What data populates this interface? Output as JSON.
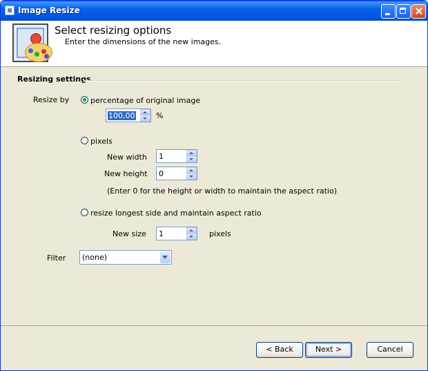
{
  "window": {
    "title": "Image Resize"
  },
  "header": {
    "title": "Select resizing options",
    "subtitle": "Enter the dimensions of the new images.",
    "icon": "paint-palette-image-icon"
  },
  "group": {
    "title": "Resizing settings"
  },
  "resize_by": {
    "label": "Resize by",
    "percentage": {
      "label": "percentage of original image",
      "value": "100,00",
      "unit": "%",
      "checked": true
    },
    "pixels": {
      "label": "pixels",
      "checked": false,
      "width_label": "New width",
      "width_value": "1",
      "height_label": "New height",
      "height_value": "0",
      "hint": "(Enter 0 for the height or width to maintain the aspect ratio)"
    },
    "longest": {
      "label": "resize longest side and maintain aspect ratio",
      "checked": false,
      "size_label": "New size",
      "size_value": "1",
      "unit": "pixels"
    }
  },
  "filter": {
    "label": "Filter",
    "value": "(none)"
  },
  "buttons": {
    "back": "< Back",
    "next": "Next >",
    "cancel": "Cancel"
  },
  "colors": {
    "titlebar": "#0054E3",
    "background": "#ECE9D8",
    "selection": "#316AC5"
  }
}
